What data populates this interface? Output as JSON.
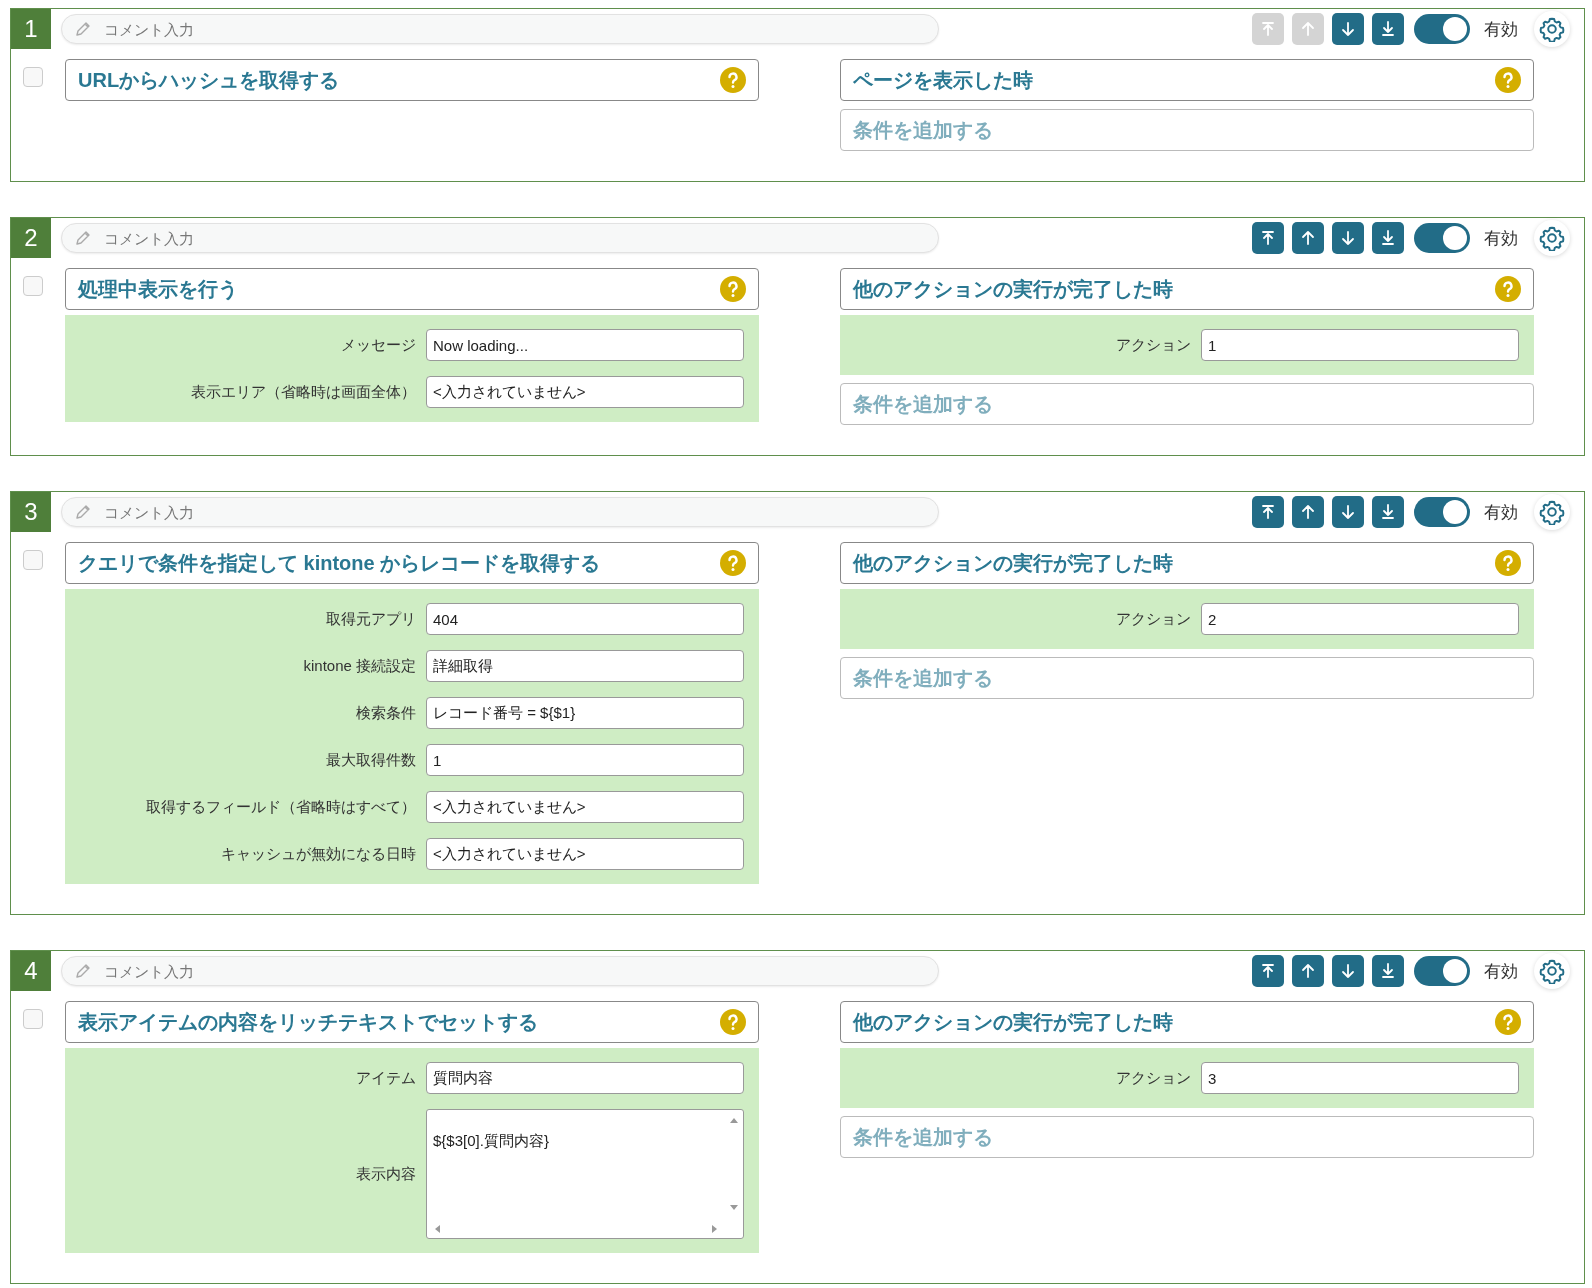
{
  "rules": [
    {
      "number": "1",
      "comment_placeholder": "コメント入力",
      "move_buttons": [
        {
          "kind": "top",
          "disabled": true
        },
        {
          "kind": "up",
          "disabled": true
        },
        {
          "kind": "down",
          "disabled": false
        },
        {
          "kind": "bottom",
          "disabled": false
        }
      ],
      "enabled": true,
      "enabled_label": "有効",
      "checked": false,
      "action": {
        "title": "URLからハッシュを取得する"
      },
      "trigger": {
        "title": "ページを表示した時"
      },
      "add_condition": "条件を追加する"
    },
    {
      "number": "2",
      "comment_placeholder": "コメント入力",
      "move_buttons": [
        {
          "kind": "top",
          "disabled": false
        },
        {
          "kind": "up",
          "disabled": false
        },
        {
          "kind": "down",
          "disabled": false
        },
        {
          "kind": "bottom",
          "disabled": false
        }
      ],
      "enabled": true,
      "enabled_label": "有効",
      "checked": false,
      "action": {
        "title": "処理中表示を行う",
        "fields": [
          {
            "kind": "input",
            "label": "メッセージ",
            "value": "Now loading..."
          },
          {
            "kind": "input",
            "label": "表示エリア（省略時は画面全体）",
            "value": "<入力されていません>"
          }
        ]
      },
      "trigger": {
        "title": "他のアクションの実行が完了した時",
        "fields": [
          {
            "kind": "input",
            "label": "アクション",
            "value": "1"
          }
        ]
      },
      "add_condition": "条件を追加する"
    },
    {
      "number": "3",
      "comment_placeholder": "コメント入力",
      "move_buttons": [
        {
          "kind": "top",
          "disabled": false
        },
        {
          "kind": "up",
          "disabled": false
        },
        {
          "kind": "down",
          "disabled": false
        },
        {
          "kind": "bottom",
          "disabled": false
        }
      ],
      "enabled": true,
      "enabled_label": "有効",
      "checked": false,
      "action": {
        "title": "クエリで条件を指定して kintone からレコードを取得する",
        "fields": [
          {
            "kind": "input",
            "label": "取得元アプリ",
            "value": "404"
          },
          {
            "kind": "input",
            "label": "kintone 接続設定",
            "value": "詳細取得"
          },
          {
            "kind": "input",
            "label": "検索条件",
            "value": "レコード番号 = ${$1}"
          },
          {
            "kind": "input",
            "label": "最大取得件数",
            "value": "1"
          },
          {
            "kind": "input",
            "label": "取得するフィールド（省略時はすべて）",
            "value": "<入力されていません>"
          },
          {
            "kind": "input",
            "label": "キャッシュが無効になる日時",
            "value": "<入力されていません>"
          }
        ]
      },
      "trigger": {
        "title": "他のアクションの実行が完了した時",
        "fields": [
          {
            "kind": "input",
            "label": "アクション",
            "value": "2"
          }
        ]
      },
      "add_condition": "条件を追加する"
    },
    {
      "number": "4",
      "comment_placeholder": "コメント入力",
      "move_buttons": [
        {
          "kind": "top",
          "disabled": false
        },
        {
          "kind": "up",
          "disabled": false
        },
        {
          "kind": "down",
          "disabled": false
        },
        {
          "kind": "bottom",
          "disabled": false
        }
      ],
      "enabled": true,
      "enabled_label": "有効",
      "checked": false,
      "action": {
        "title": "表示アイテムの内容をリッチテキストでセットする",
        "fields": [
          {
            "kind": "input",
            "label": "アイテム",
            "value": "質問内容"
          },
          {
            "kind": "textarea",
            "label": "表示内容",
            "value": "${$3[0].質問内容}"
          }
        ]
      },
      "trigger": {
        "title": "他のアクションの実行が完了した時",
        "fields": [
          {
            "kind": "input",
            "label": "アクション",
            "value": "3"
          }
        ]
      },
      "add_condition": "条件を追加する"
    }
  ]
}
